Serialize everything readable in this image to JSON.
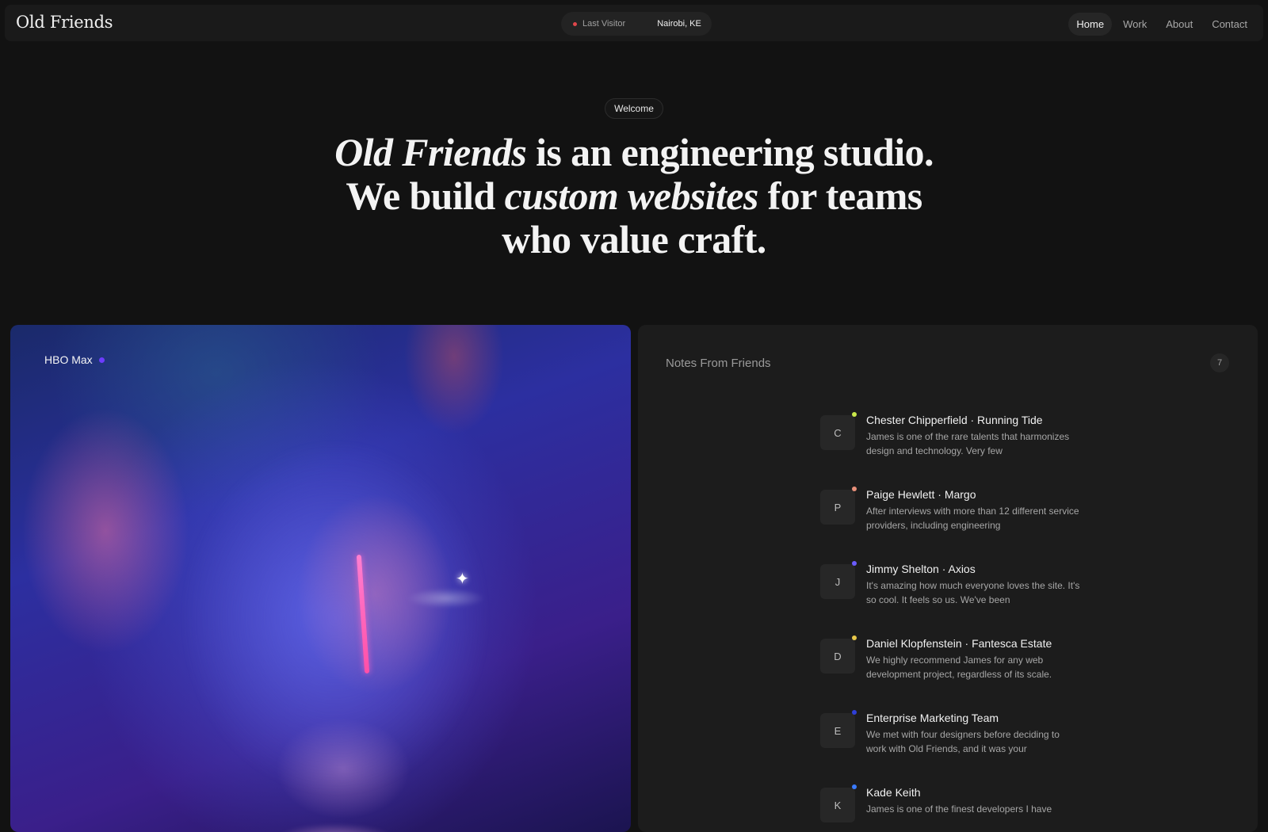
{
  "nav": {
    "brand": "Old Friends",
    "visitor_label": "Last Visitor",
    "visitor_city": "Nairobi, KE",
    "visitor_dot_color": "#e0464b",
    "links": [
      "Home",
      "Work",
      "About",
      "Contact"
    ],
    "active_link": "Home"
  },
  "hero": {
    "badge": "Welcome",
    "line1_em": "Old Friends",
    "line1_rest": " is an engineering studio.",
    "line2_a": "We build ",
    "line2_em": "custom websites",
    "line2_b": " for teams",
    "line3": "who value craft."
  },
  "media": {
    "label": "HBO Max",
    "dot_color": "#6d3cff",
    "image_icon": "portrait-image"
  },
  "notes": {
    "title": "Notes From Friends",
    "count": "7",
    "items": [
      {
        "initial": "C",
        "name": "Chester Chipperfield · Running Tide",
        "text": "James is one of the rare talents that harmonizes design and technology. Very few",
        "dot": "#c9e84a"
      },
      {
        "initial": "P",
        "name": "Paige Hewlett · Margo",
        "text": "After interviews with more than 12 different service providers, including engineering",
        "dot": "#e8907a"
      },
      {
        "initial": "J",
        "name": "Jimmy Shelton · Axios",
        "text": "It's amazing how much everyone loves the site. It's so cool. It feels so us. We've been",
        "dot": "#6b5cff"
      },
      {
        "initial": "D",
        "name": "Daniel Klopfenstein · Fantesca Estate",
        "text": "We highly recommend James for any web development project, regardless of its scale.",
        "dot": "#e8c84a"
      },
      {
        "initial": "E",
        "name": "Enterprise Marketing Team",
        "text": "We met with four designers before deciding to work with Old Friends, and it was your",
        "dot": "#2f3fd8"
      },
      {
        "initial": "K",
        "name": "Kade Keith",
        "text": "James is one of the finest developers I have",
        "dot": "#3a7bff"
      }
    ]
  }
}
